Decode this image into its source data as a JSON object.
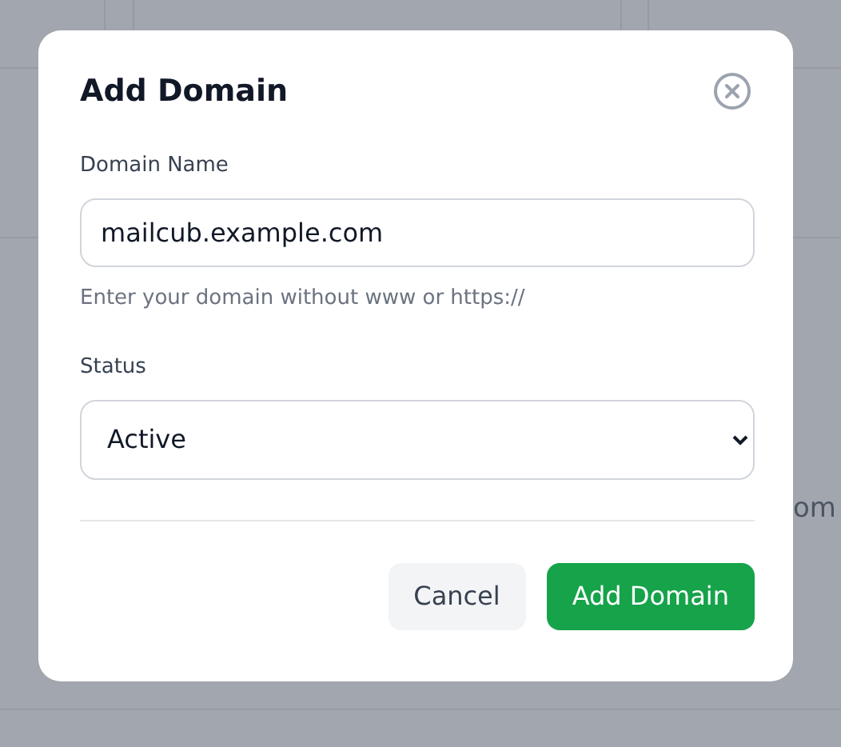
{
  "background": {
    "text_fragment": "om"
  },
  "dialog": {
    "title": "Add Domain",
    "fields": [
      {
        "kind": "text",
        "label": "Domain Name",
        "value": "mailcub.example.com",
        "help": "Enter your domain without www or https://"
      },
      {
        "kind": "select",
        "label": "Status",
        "value": "Active"
      }
    ],
    "buttons": [
      {
        "label": "Cancel",
        "kind": "secondary"
      },
      {
        "label": "Add Domain",
        "kind": "primary"
      }
    ]
  }
}
